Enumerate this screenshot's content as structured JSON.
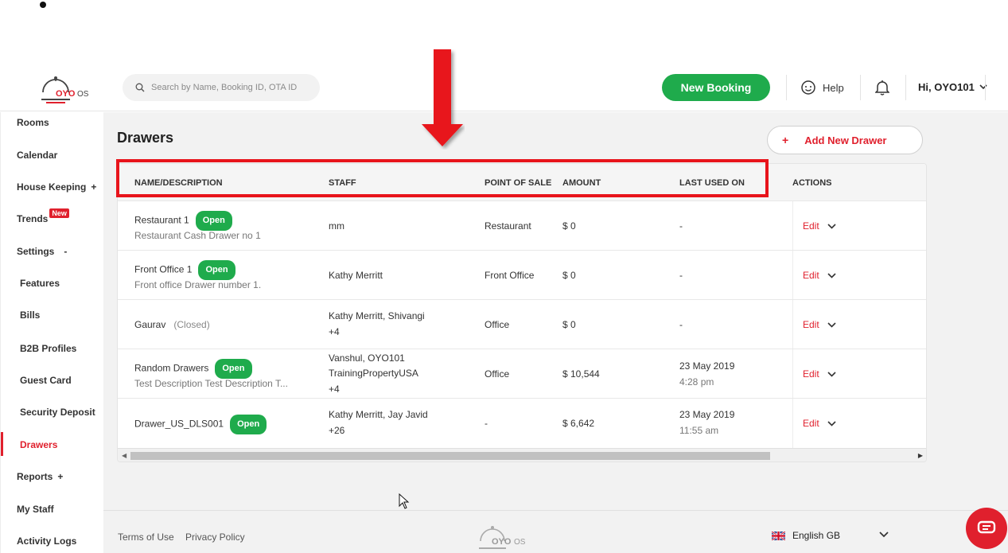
{
  "header": {
    "logo_text": "OYO OS",
    "search_placeholder": "Search by Name, Booking ID, OTA ID",
    "new_booking_label": "New Booking",
    "help_label": "Help",
    "user_label": "Hi, OYO101"
  },
  "sidebar": {
    "items": [
      {
        "label": "Rooms"
      },
      {
        "label": "Calendar"
      },
      {
        "label": "House Keeping",
        "expander": "+"
      },
      {
        "label": "Trends",
        "badge": "New"
      },
      {
        "label": "Settings",
        "expander": "-"
      },
      {
        "label": "Features"
      },
      {
        "label": "Bills"
      },
      {
        "label": "B2B Profiles"
      },
      {
        "label": "Guest Card"
      },
      {
        "label": "Security Deposit"
      },
      {
        "label": "Drawers"
      },
      {
        "label": "Reports",
        "expander": "+"
      },
      {
        "label": "My Staff"
      },
      {
        "label": "Activity Logs"
      }
    ]
  },
  "page": {
    "title": "Drawers",
    "add_button_label": "Add New Drawer",
    "add_button_icon": "+"
  },
  "table": {
    "columns": [
      "NAME/DESCRIPTION",
      "STAFF",
      "POINT OF SALE",
      "AMOUNT",
      "LAST USED ON",
      "ACTIONS"
    ],
    "rows": [
      {
        "name": "Restaurant 1",
        "status": "Open",
        "description": "Restaurant Cash Drawer no 1",
        "staff": [
          "mm"
        ],
        "pos": "Restaurant",
        "amount": "$ 0",
        "last_used": [
          "-"
        ],
        "action": "Edit"
      },
      {
        "name": "Front Office 1",
        "status": "Open",
        "description": "Front office Drawer number 1.",
        "staff": [
          "Kathy Merritt"
        ],
        "pos": "Front Office",
        "amount": "$ 0",
        "last_used": [
          "-"
        ],
        "action": "Edit"
      },
      {
        "name": "Gaurav",
        "status": "(Closed)",
        "description": "",
        "staff": [
          "Kathy Merritt, Shivangi",
          "+4"
        ],
        "pos": "Office",
        "amount": "$ 0",
        "last_used": [
          "-"
        ],
        "action": "Edit"
      },
      {
        "name": "Random Drawers",
        "status": "Open",
        "description": "Test Description Test Description T...",
        "staff": [
          "Vanshul, OYO101",
          "TrainingPropertyUSA",
          "+4"
        ],
        "pos": "Office",
        "amount": "$ 10,544",
        "last_used": [
          "23 May 2019",
          "4:28 pm"
        ],
        "action": "Edit"
      },
      {
        "name": "Drawer_US_DLS001",
        "status": "Open",
        "description": "",
        "staff": [
          "Kathy Merritt, Jay Javid",
          "+26"
        ],
        "pos": "-",
        "amount": "$ 6,642",
        "last_used": [
          "23 May 2019",
          "11:55 am"
        ],
        "action": "Edit"
      }
    ]
  },
  "footer": {
    "terms_label": "Terms of Use",
    "privacy_label": "Privacy Policy",
    "logo_text": "OYO OS",
    "language_label": "English GB"
  },
  "colors": {
    "accent_red": "#e0202d",
    "open_green": "#1fab4c",
    "annotation_red": "#e8141b"
  }
}
